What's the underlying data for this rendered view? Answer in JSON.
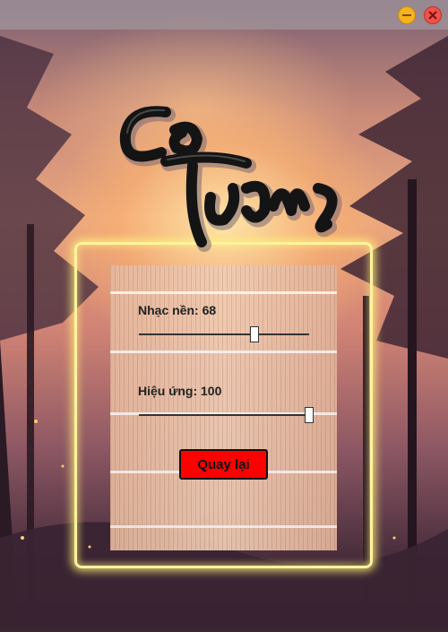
{
  "game_title": "Cờ Tướng",
  "settings": {
    "music": {
      "label": "Nhạc nền: 68",
      "value": 68,
      "max": 100
    },
    "effects": {
      "label": "Hiệu ứng: 100",
      "value": 100,
      "max": 100
    }
  },
  "back_button": {
    "label": "Quay lại"
  },
  "window_controls": [
    "minimize-icon",
    "close-icon"
  ],
  "colors": {
    "glow": "#fff3a0",
    "button": "#ff0000"
  }
}
